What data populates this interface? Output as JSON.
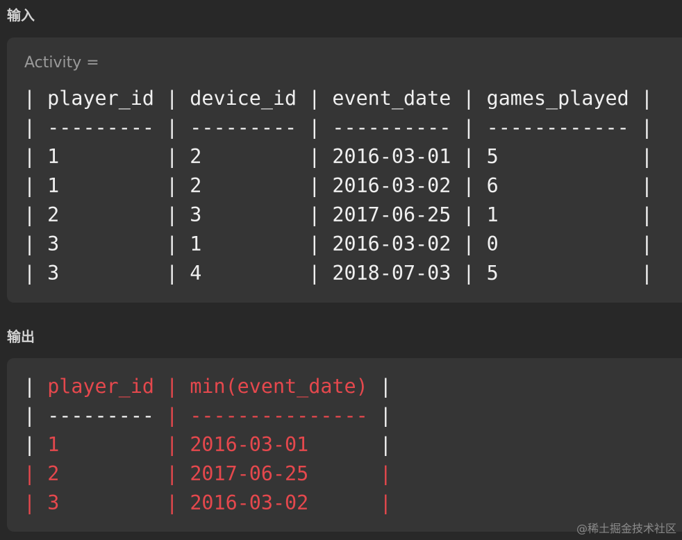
{
  "input_section": {
    "heading": "输入",
    "caption": "Activity =",
    "lines": [
      "| player_id | device_id | event_date | games_played |",
      "| --------- | --------- | ---------- | ------------ |",
      "| 1         | 2         | 2016-03-01 | 5            |",
      "| 1         | 2         | 2016-03-02 | 6            |",
      "| 2         | 3         | 2017-06-25 | 1            |",
      "| 3         | 1         | 2016-03-02 | 0            |",
      "| 3         | 4         | 2018-07-03 | 5            |"
    ]
  },
  "output_section": {
    "heading": "输出",
    "lines": [
      {
        "l1": "| ",
        "v1": "player_id",
        "s1": " | ",
        "v2": "min(event_date)",
        "e": " |"
      },
      {
        "l1": "| ",
        "v1": "---------",
        "s1": " | ",
        "v2": "---------------",
        "e": " |"
      },
      {
        "l1": "| ",
        "v1": "1        ",
        "s1": " | ",
        "v2": "2016-03-01     ",
        "e": " |"
      },
      {
        "l1": "| ",
        "v1": "2        ",
        "s1": " | ",
        "v2": "2017-06-25     ",
        "e": " |"
      },
      {
        "l1": "| ",
        "v1": "3        ",
        "s1": " | ",
        "v2": "2016-03-02     ",
        "e": " |"
      }
    ]
  },
  "watermark": "@稀土掘金技术社区",
  "colors": {
    "background": "#282828",
    "panel": "#353535",
    "code_text": "#f0f0f0",
    "highlight_red": "#e5484d",
    "caption": "#9a9a9a"
  }
}
